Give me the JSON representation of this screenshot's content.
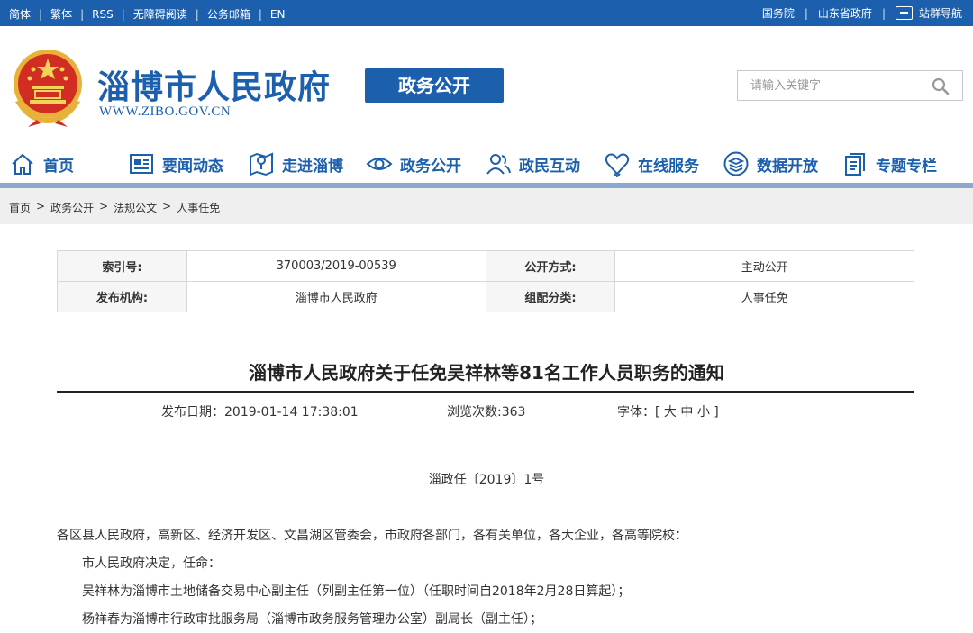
{
  "topbar": {
    "left_links": [
      "简体",
      "繁体",
      "RSS",
      "无障碍阅读",
      "公务邮箱",
      "EN"
    ],
    "right_links": [
      "国务院",
      "山东省政府"
    ],
    "site_nav": "站群导航"
  },
  "header": {
    "title": "淄博市人民政府",
    "url": "WWW.ZIBO.GOV.CN",
    "badge": "政务公开",
    "search_placeholder": "请输入关键字"
  },
  "nav": [
    {
      "label": "首页",
      "icon": "home-icon"
    },
    {
      "label": "要闻动态",
      "icon": "news-icon"
    },
    {
      "label": "走进淄博",
      "icon": "map-icon"
    },
    {
      "label": "政务公开",
      "icon": "eye-icon"
    },
    {
      "label": "政民互动",
      "icon": "people-icon"
    },
    {
      "label": "在线服务",
      "icon": "heart-icon"
    },
    {
      "label": "数据开放",
      "icon": "layers-icon"
    },
    {
      "label": "专题专栏",
      "icon": "document-icon"
    }
  ],
  "breadcrumb": [
    "首页",
    "政务公开",
    "法规公文",
    "人事任免"
  ],
  "info": {
    "index_label": "索引号:",
    "index_value": "370003/2019-00539",
    "open_label": "公开方式:",
    "open_value": "主动公开",
    "org_label": "发布机构:",
    "org_value": "淄博市人民政府",
    "cat_label": "组配分类:",
    "cat_value": "人事任免"
  },
  "article": {
    "title": "淄博市人民政府关于任免吴祥林等81名工作人员职务的通知",
    "date": "发布日期：2019-01-14 17:38:01",
    "views": "浏览次数:363",
    "font_label": "字体：[",
    "font_large": "大",
    "font_medium": "中",
    "font_small": "小",
    "font_end": "]",
    "doc_no": "淄政任〔2019〕1号",
    "addressee": "各区县人民政府，高新区、经济开发区、文昌湖区管委会，市政府各部门，各有关单位，各大企业，各高等院校：",
    "p1": "市人民政府决定，任命：",
    "p2": "吴祥林为淄博市土地储备交易中心副主任（列副主任第一位）（任职时间自2018年2月28日算起）；",
    "p3": "杨祥春为淄博市行政审批服务局（淄博市政务服务管理办公室）副局长（副主任）；"
  },
  "colors": {
    "brand": "#1c5fac",
    "nav_line": "#8ba9cf",
    "breadcrumb_bg": "#efefef"
  }
}
